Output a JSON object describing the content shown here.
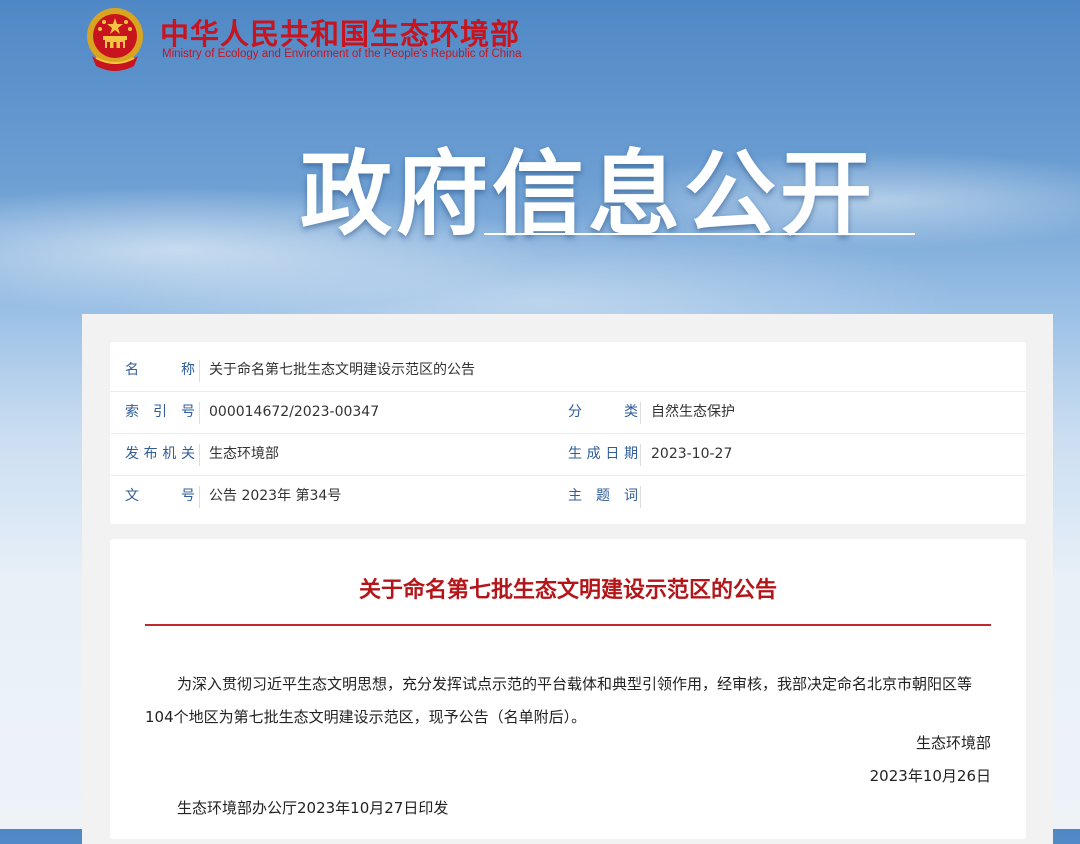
{
  "header": {
    "site_name_cn": "中华人民共和国生态环境部",
    "site_name_en": "Ministry of Ecology and Environment of the People's Republic of China",
    "emblem_icon": "national-emblem-icon"
  },
  "banner": {
    "title": "政府信息公开"
  },
  "meta": {
    "name_label": "名　　称",
    "name_value": "关于命名第七批生态文明建设示范区的公告",
    "index_label": "索 引 号",
    "index_value": "000014672/2023-00347",
    "category_label": "分　　类",
    "category_value": "自然生态保护",
    "issuer_label": "发布机关",
    "issuer_value": "生态环境部",
    "date_label": "生成日期",
    "date_value": "2023-10-27",
    "docno_label": "文　　号",
    "docno_value": "公告 2023年 第34号",
    "subject_label": "主 题 词",
    "subject_value": ""
  },
  "document": {
    "title": "关于命名第七批生态文明建设示范区的公告",
    "paragraph": "为深入贯彻习近平生态文明思想，充分发挥试点示范的平台载体和典型引领作用，经审核，我部决定命名北京市朝阳区等104个地区为第七批生态文明建设示范区，现予公告（名单附后）。",
    "signature_org": "生态环境部",
    "signature_date": "2023年10月26日",
    "issued_note": "生态环境部办公厅2023年10月27日印发"
  },
  "colors": {
    "brand_red": "#c8141e",
    "title_red": "#b31519",
    "label_blue": "#2f5d9a"
  }
}
